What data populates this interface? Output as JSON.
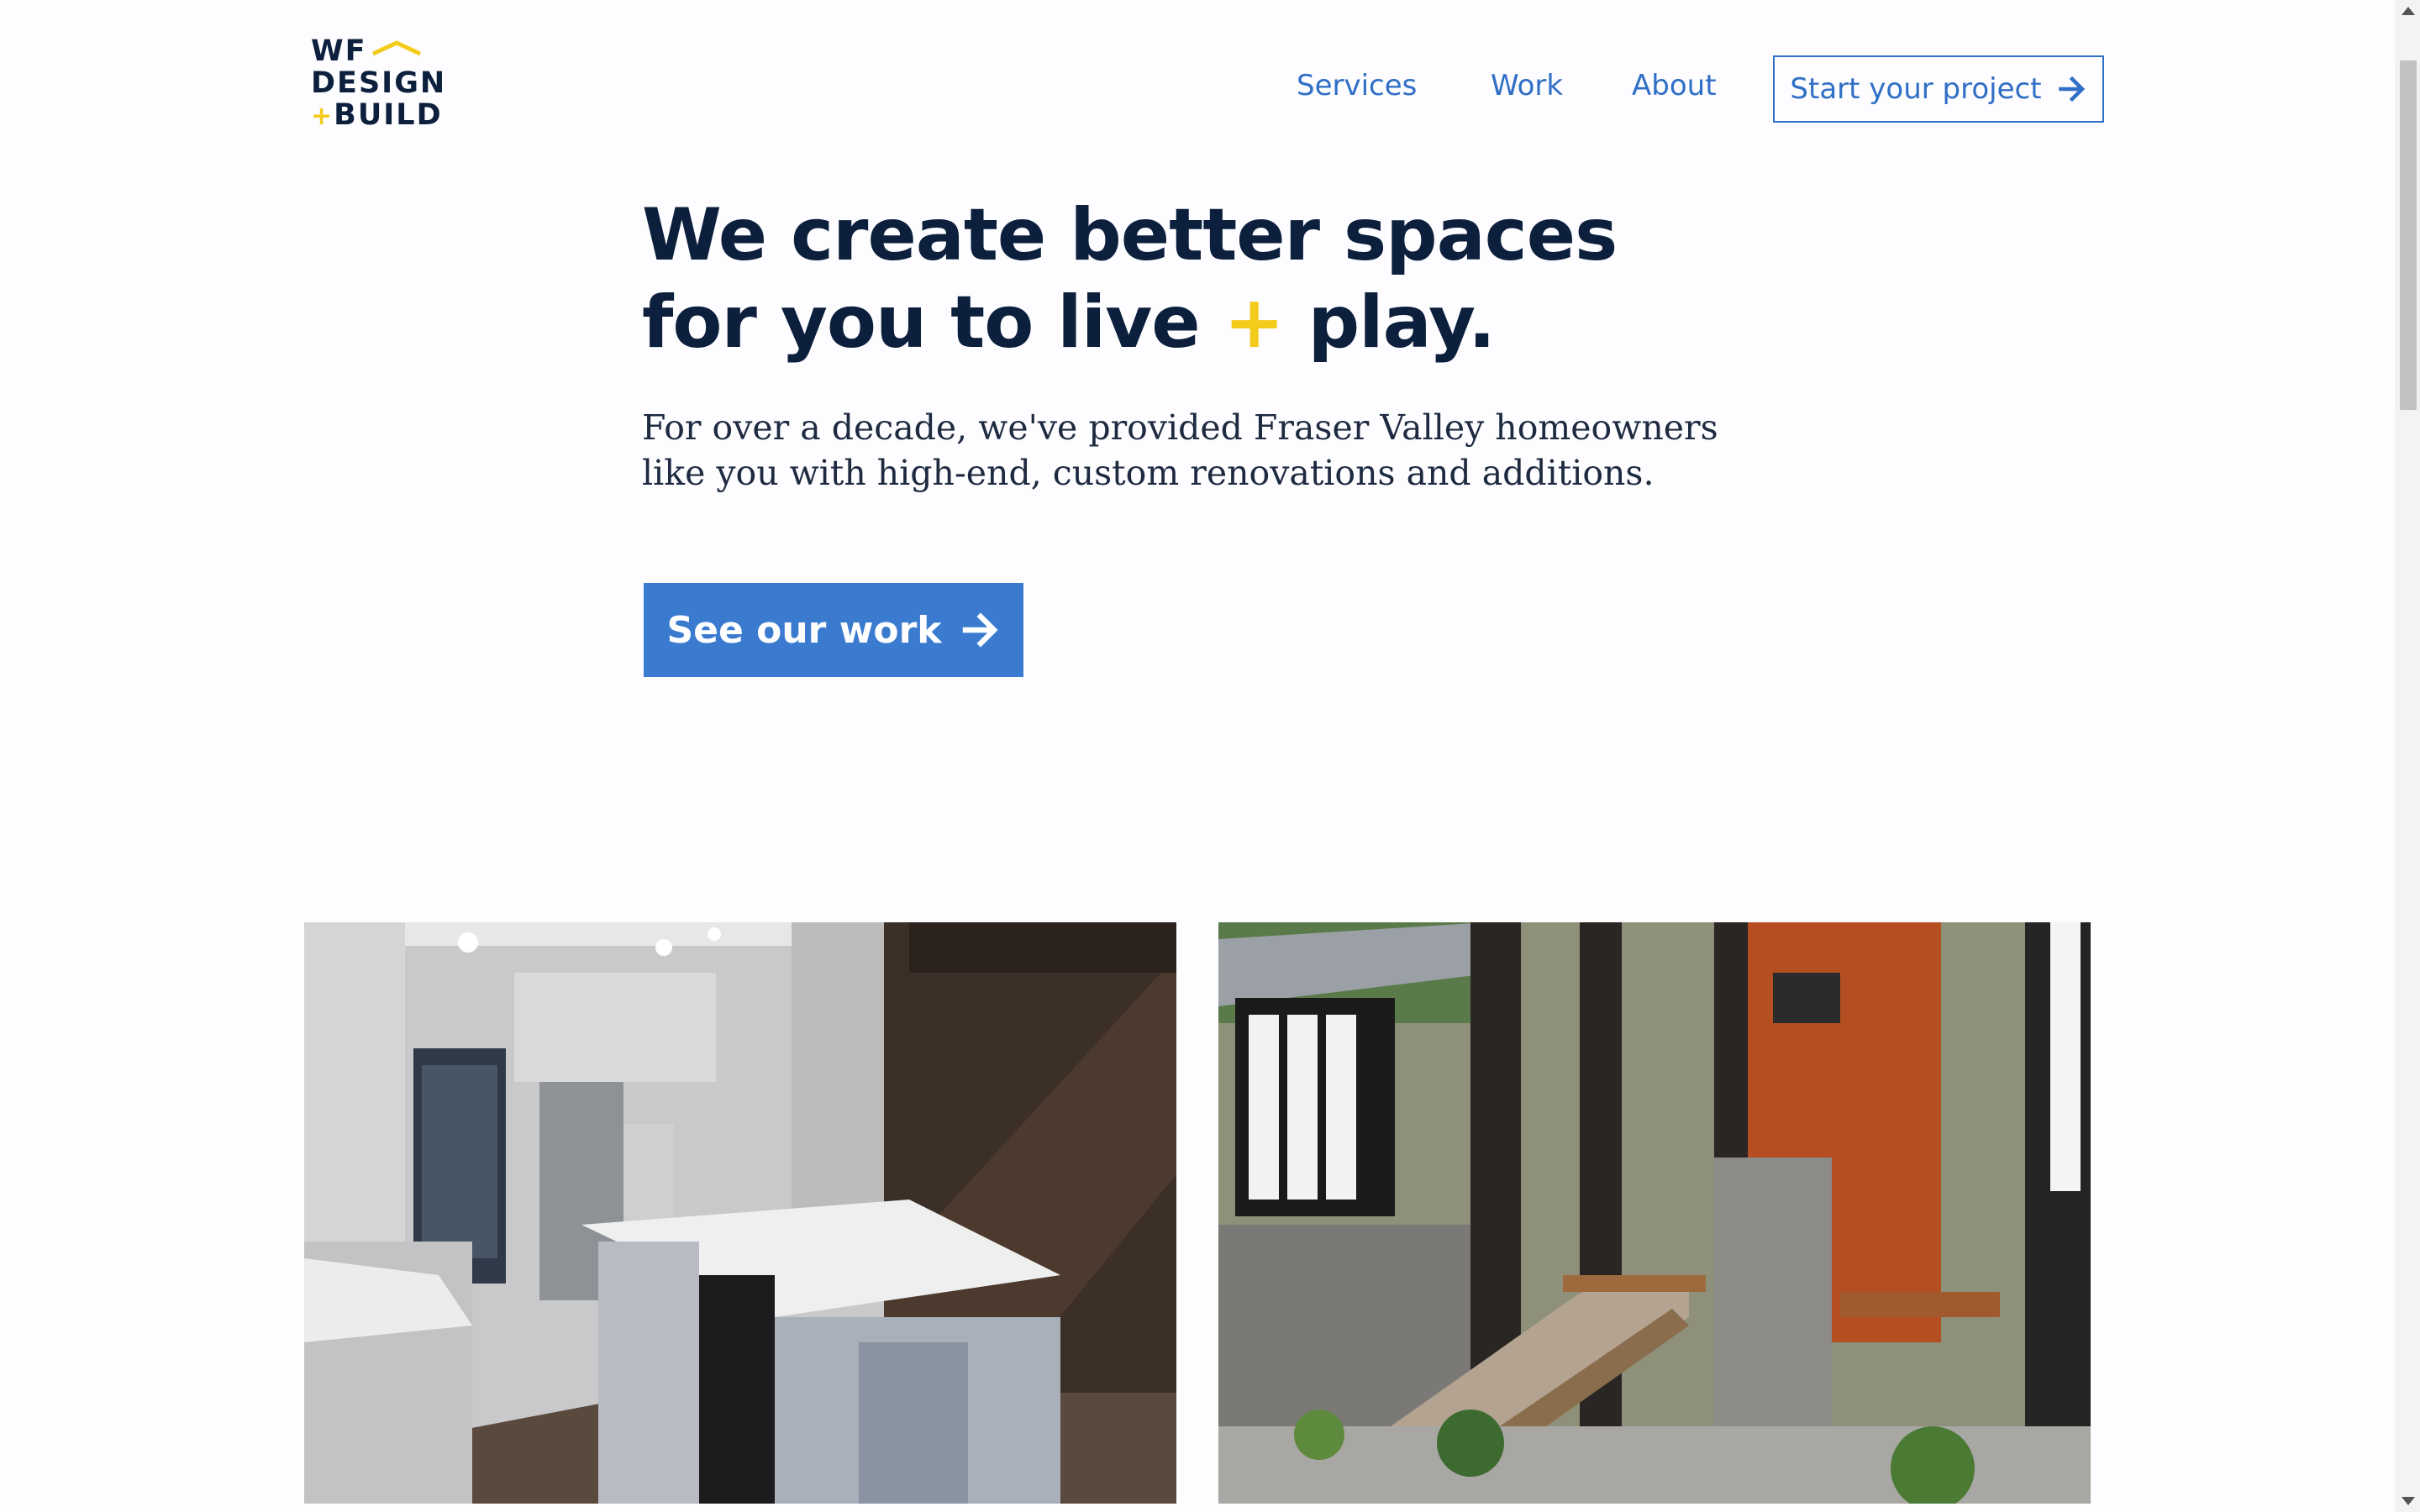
{
  "brand": {
    "line1": "WF",
    "line2": "DESIGN",
    "line3": "BUILD",
    "plus": "+",
    "accent_color": "#f3cc1b",
    "ink_color": "#0c1f3d"
  },
  "nav": {
    "items": [
      {
        "label": "Services"
      },
      {
        "label": "Work"
      },
      {
        "label": "About"
      }
    ],
    "cta_label": "Start your project",
    "cta_icon": "arrow-right-icon",
    "link_color": "#2f6fc6"
  },
  "hero": {
    "title_line1": "We create better spaces",
    "title_line2_a": "for you to live",
    "title_plus": "+",
    "title_line2_b": "play.",
    "subtitle": "For over a decade, we've provided Fraser Valley homeowners like you with high-end, custom renovations and additions.",
    "button_label": "See our work",
    "button_icon": "arrow-right-icon",
    "button_color": "#3a7bd0"
  },
  "gallery": [
    {
      "subject": "kitchen-photo"
    },
    {
      "subject": "house-porch-photo"
    }
  ]
}
